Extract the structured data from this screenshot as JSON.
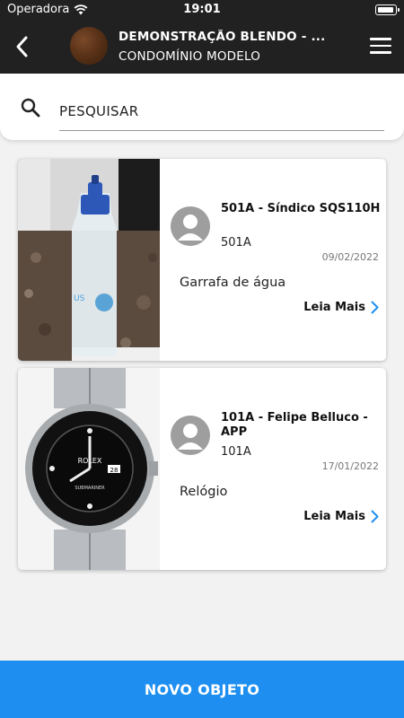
{
  "status_bar": {
    "carrier": "Operadora",
    "time": "19:01"
  },
  "header": {
    "title": "DEMONSTRAÇÃO BLENDO - ...",
    "subtitle": "CONDOMÍNIO MODELO"
  },
  "search": {
    "placeholder": "PESQUISAR"
  },
  "items": [
    {
      "name": "501A - Síndico SQS110H",
      "unit": "501A",
      "date": "09/02/2022",
      "description": "Garrafa de água",
      "more_label": "Leia Mais"
    },
    {
      "name": "101A - Felipe Belluco - APP",
      "unit": "101A",
      "date": "17/01/2022",
      "description": "Relógio",
      "more_label": "Leia Mais"
    }
  ],
  "footer": {
    "button_label": "NOVO OBJETO"
  },
  "colors": {
    "header_bg": "#212121",
    "accent": "#1e8ff0",
    "background": "#f2f2f2"
  }
}
